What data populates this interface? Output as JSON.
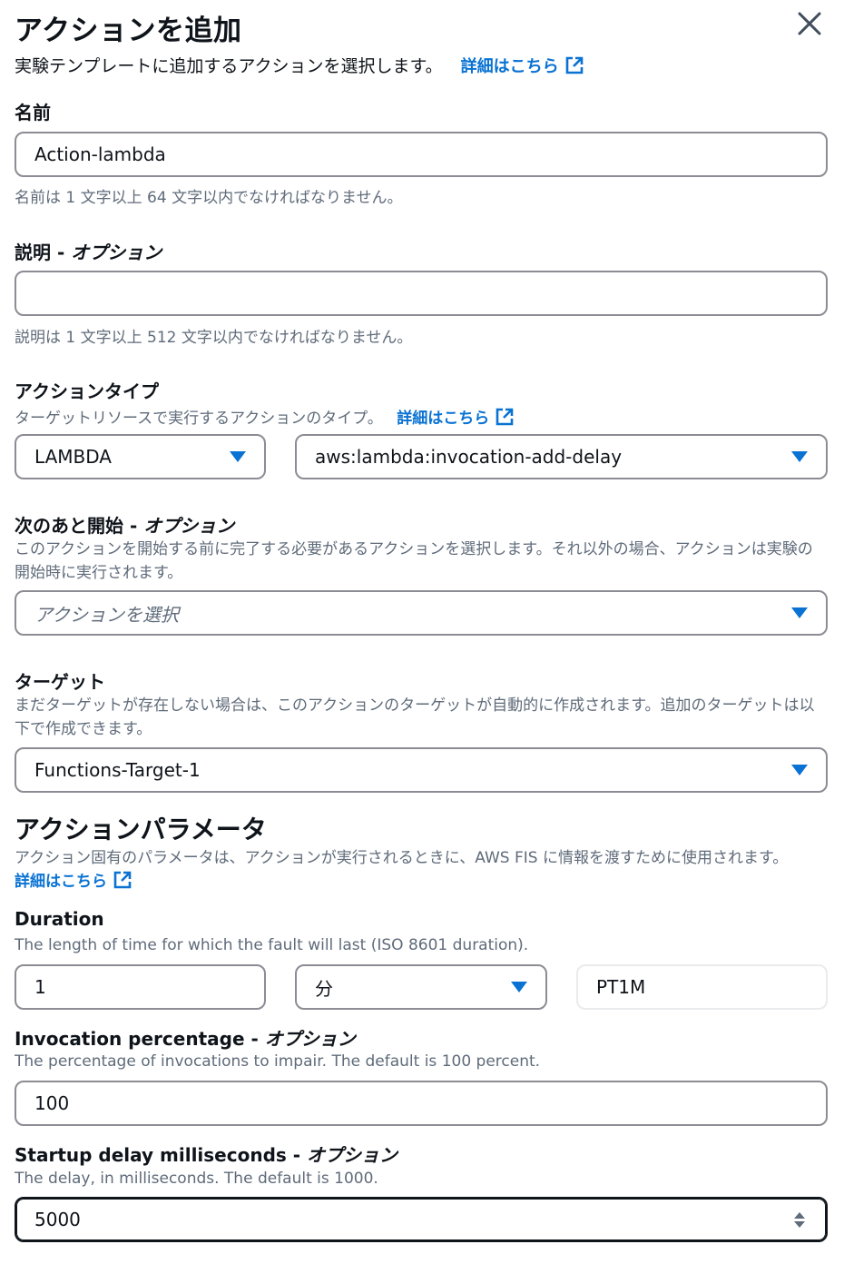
{
  "header": {
    "title": "アクションを追加",
    "subtitle": "実験テンプレートに追加するアクションを選択します。",
    "learn_more": "詳細はこちら"
  },
  "name_field": {
    "label": "名前",
    "value": "Action-lambda",
    "hint": "名前は 1 文字以上 64 文字以内でなければなりません。"
  },
  "description_field": {
    "label": "説明",
    "optional": "オプション",
    "value": "",
    "hint": "説明は 1 文字以上 512 文字以内でなければなりません。"
  },
  "action_type": {
    "label": "アクションタイプ",
    "description": "ターゲットリソースで実行するアクションのタイプ。",
    "learn_more": "詳細はこちら",
    "service_value": "LAMBDA",
    "action_value": "aws:lambda:invocation-add-delay"
  },
  "start_after": {
    "label": "次のあと開始",
    "optional": "オプション",
    "description": "このアクションを開始する前に完了する必要があるアクションを選択します。それ以外の場合、アクションは実験の開始時に実行されます。",
    "placeholder": "アクションを選択"
  },
  "target": {
    "label": "ターゲット",
    "description": "まだターゲットが存在しない場合は、このアクションのターゲットが自動的に作成されます。追加のターゲットは以下で作成できます。",
    "value": "Functions-Target-1"
  },
  "action_parameters": {
    "heading": "アクションパラメータ",
    "description": "アクション固有のパラメータは、アクションが実行されるときに、AWS FIS に情報を渡すために使用されます。",
    "learn_more": "詳細はこちら",
    "duration": {
      "label": "Duration",
      "description": "The length of time for which the fault will last (ISO 8601 duration).",
      "amount": "1",
      "unit": "分",
      "iso_value": "PT1M"
    },
    "invocation_percentage": {
      "label": "Invocation percentage",
      "optional": "オプション",
      "description": "The percentage of invocations to impair. The default is 100 percent.",
      "value": "100"
    },
    "startup_delay": {
      "label": "Startup delay milliseconds",
      "optional": "オプション",
      "description": "The delay, in milliseconds. The default is 1000.",
      "value": "5000"
    }
  },
  "colors": {
    "link": "#0972d3",
    "text": "#0f141a",
    "secondary_text": "#5f6b7a",
    "border": "#8c8c94"
  },
  "icons": [
    "close-icon",
    "external-link-icon",
    "caret-down-icon",
    "stepper-icon"
  ]
}
